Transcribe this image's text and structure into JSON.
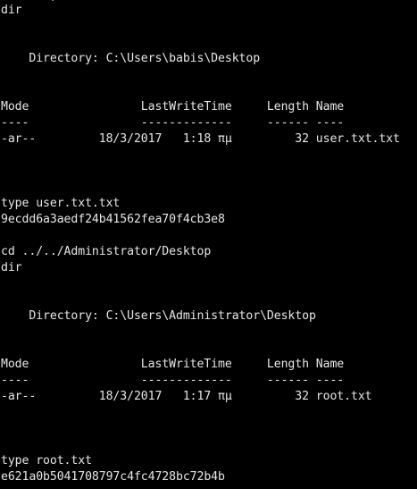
{
  "terminal": {
    "top_fragment": "       ,",
    "lines": [
      "dir",
      "",
      "",
      "    Directory: C:\\Users\\babis\\Desktop",
      "",
      "",
      "Mode                LastWriteTime     Length Name",
      "----                -------------     ------ ----",
      "-ar--         18/3/2017   1:18 πμ         32 user.txt.txt",
      "",
      "",
      "",
      "type user.txt.txt",
      "9ecdd6a3aedf24b41562fea70f4cb3e8",
      "",
      "cd ../../Administrator/Desktop",
      "dir",
      "",
      "",
      "    Directory: C:\\Users\\Administrator\\Desktop",
      "",
      "",
      "Mode                LastWriteTime     Length Name",
      "----                -------------     ------ ----",
      "-ar--         18/3/2017   1:17 πμ         32 root.txt",
      "",
      "",
      "",
      "type root.txt",
      "e621a0b5041708797c4fc4728bc72b4b"
    ]
  }
}
